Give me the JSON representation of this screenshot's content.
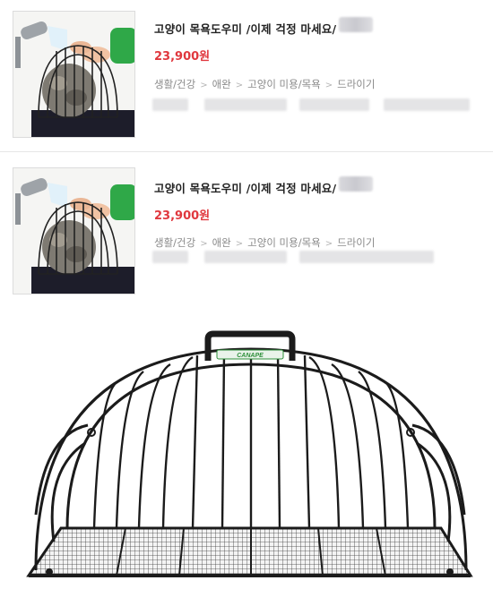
{
  "listings": [
    {
      "title": "고양이 목욕도우미 /이제 걱정 마세요/",
      "price": "23,900원",
      "category": [
        "생활/건강",
        "애완",
        "고양이 미용/목욕",
        "드라이기"
      ]
    },
    {
      "title": "고양이 목욕도우미 /이제 걱정 마세요/",
      "price": "23,900원",
      "category": [
        "생활/건강",
        "애완",
        "고양이 미용/목욕",
        "드라이기"
      ]
    }
  ],
  "category_separator": ">",
  "colors": {
    "price": "#e0383e",
    "title": "#222222",
    "category": "#8a8a8a",
    "cage_wire": "#1b1b1b",
    "cage_logo": "#2d8f3a"
  },
  "main_image": {
    "subject": "cat bath cage product photo"
  }
}
